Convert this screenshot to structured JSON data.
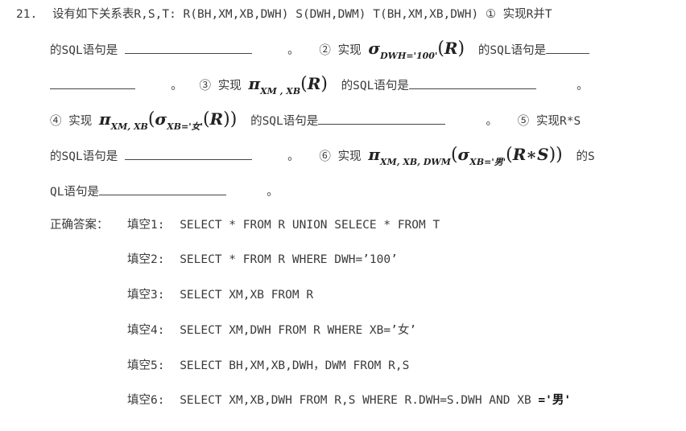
{
  "question": {
    "number": "21.",
    "line1": {
      "text": "设有如下关系表R,S,T: R(BH,XM,XB,DWH) S(DWH,DWM) T(BH,XM,XB,DWH) ",
      "item1": "① 实现R并T"
    },
    "line2": {
      "prefix": "的SQL语句是",
      "end1": "。",
      "item2": "② 实现",
      "sigma": "σ",
      "sigma_sub": "DWH='100'",
      "open": "(",
      "rel": "R",
      "close": ")",
      "suffix": "的SQL语句是"
    },
    "line3": {
      "end": "。",
      "item3": "③ 实现",
      "pi": "π",
      "pi_sub": "XM , XB",
      "open": "(",
      "rel": "R",
      "close": ")",
      "suffix": "的SQL语句是",
      "end2": "。"
    },
    "line4": {
      "item4": "④ 实现",
      "pi": "π",
      "pi_sub": "XM, XB",
      "open1": "(",
      "sigma": "σ",
      "sigma_sub": "XB='女'",
      "open2": "(",
      "rel": "R",
      "close": "))",
      "suffix": "的SQL语句是",
      "end": "。",
      "item5": "⑤ 实现R*S"
    },
    "line5": {
      "prefix": "的SQL语句是",
      "end": "。",
      "item6": "⑥ 实现",
      "pi": "π",
      "pi_sub": "XM, XB, DWM",
      "open1": "(",
      "sigma": "σ",
      "sigma_sub": "XB='男'",
      "open2": "(",
      "rel": "R∗S",
      "close": "))",
      "suffix": "的S"
    },
    "line6": {
      "prefix": "QL语句是",
      "end": "。"
    }
  },
  "answer": {
    "label": "正确答案：",
    "items": [
      {
        "label": "填空1:",
        "value": "SELECT * FROM R UNION SELECE * FROM T"
      },
      {
        "label": "填空2:",
        "value": "SELECT * FROM R WHERE DWH=’100’"
      },
      {
        "label": "填空3:",
        "value": "SELECT XM,XB FROM R"
      },
      {
        "label": "填空4:",
        "value": "SELECT XM,DWH FROM R WHERE XB=’女’"
      },
      {
        "label": "填空5:",
        "value": "SELECT BH,XM,XB,DWH，DWM FROM R,S"
      },
      {
        "label": "填空6:",
        "value": "SELECT XM,XB,DWH FROM R,S WHERE R.DWH=S.DWH AND XB ",
        "value_bold": "='男'"
      }
    ]
  }
}
